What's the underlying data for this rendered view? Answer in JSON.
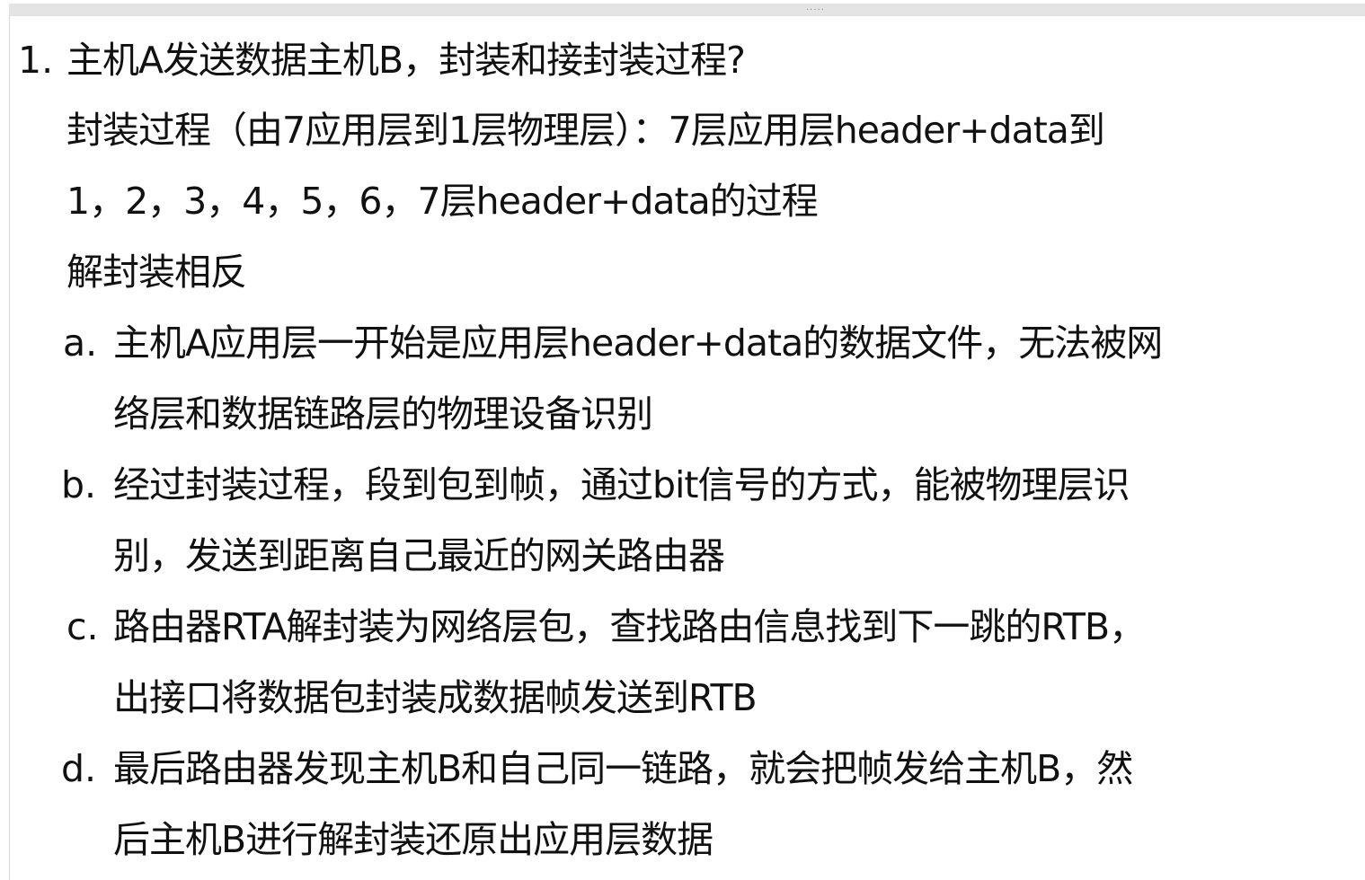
{
  "question": {
    "number": "1.",
    "title": "主机A发送数据主机B，封装和接封装过程?",
    "answer_lines": [
      "封装过程（由7应用层到1层物理层）：7层应用层header+data到",
      "1，2，3，4，5，6，7层header+data的过程",
      "解封装相反"
    ],
    "items": [
      {
        "marker": "a.",
        "lines": [
          "主机A应用层一开始是应用层header+data的数据文件，无法被网",
          "络层和数据链路层的物理设备识别"
        ]
      },
      {
        "marker": "b.",
        "lines": [
          "经过封装过程，段到包到帧，通过bit信号的方式，能被物理层识",
          "别，发送到距离自己最近的网关路由器"
        ]
      },
      {
        "marker": "c.",
        "lines": [
          "路由器RTA解封装为网络层包，查找路由信息找到下一跳的RTB，",
          "出接口将数据包封装成数据帧发送到RTB"
        ]
      },
      {
        "marker": "d.",
        "lines": [
          "最后路由器发现主机B和自己同一链路，就会把帧发给主机B，然",
          "后主机B进行解封装还原出应用层数据"
        ]
      }
    ]
  },
  "ui": {
    "drag_handle": "....."
  }
}
